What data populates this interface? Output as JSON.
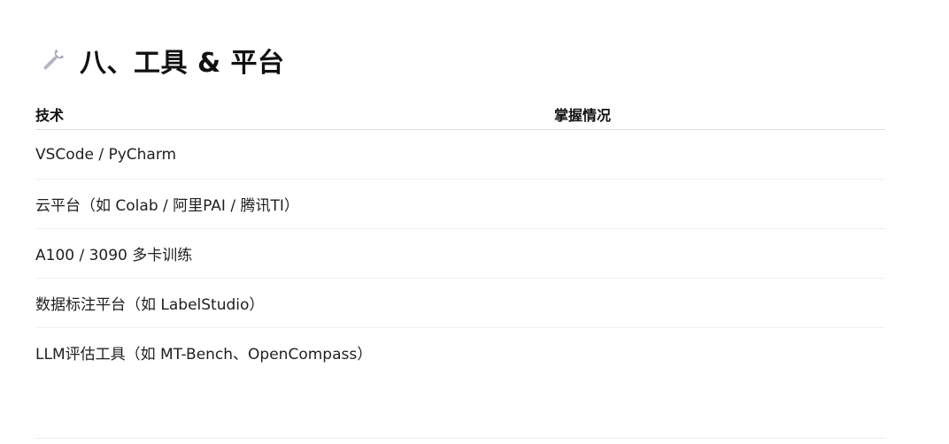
{
  "section": {
    "icon": "wrench-icon",
    "title": "八、工具 & 平台"
  },
  "table": {
    "headers": {
      "tech": "技术",
      "status": "掌握情况"
    },
    "rows": [
      {
        "tech": "VSCode / PyCharm",
        "status": ""
      },
      {
        "tech": "云平台（如 Colab / 阿里PAI / 腾讯TI）",
        "status": ""
      },
      {
        "tech": "A100 / 3090 多卡训练",
        "status": ""
      },
      {
        "tech": "数据标注平台（如 LabelStudio）",
        "status": ""
      },
      {
        "tech": "LLM评估工具（如 MT-Bench、OpenCompass）",
        "status": ""
      }
    ]
  },
  "colors": {
    "wrench": "#b9b3c6",
    "text": "#1f1f1f",
    "header_rule": "#dcdcdc"
  }
}
